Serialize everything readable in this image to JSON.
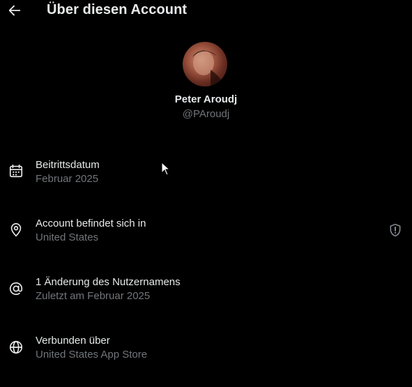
{
  "header": {
    "title": "Über diesen Account",
    "back_icon": "arrow-left-icon"
  },
  "profile": {
    "name": "Peter Aroudj",
    "handle": "@PAroudj"
  },
  "rows": [
    {
      "icon": "calendar-icon",
      "label": "Beitrittsdatum",
      "value": "Februar 2025"
    },
    {
      "icon": "location-pin-icon",
      "label": "Account befindet sich in",
      "value": "United States",
      "trailing_icon": "shield-alert-icon"
    },
    {
      "icon": "at-sign-icon",
      "label": "1 Änderung des Nutzernamens",
      "value": "Zuletzt am Februar 2025"
    },
    {
      "icon": "globe-icon",
      "label": "Verbunden über",
      "value": "United States App Store"
    }
  ],
  "colors": {
    "background": "#000000",
    "primary_text": "#e7e9ea",
    "secondary_text": "#71767b"
  }
}
